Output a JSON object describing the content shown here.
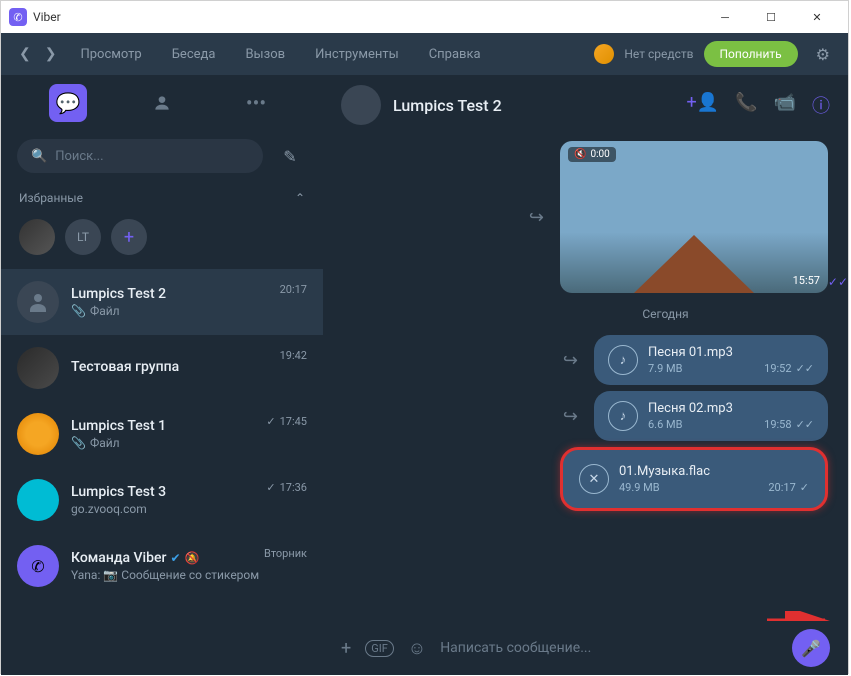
{
  "app": {
    "title": "Viber"
  },
  "menubar": {
    "items": [
      "Просмотр",
      "Беседа",
      "Вызов",
      "Инструменты",
      "Справка"
    ],
    "balance": "Нет средств",
    "topup": "Пополнить"
  },
  "sidebar": {
    "search_placeholder": "Поиск...",
    "favorites_label": "Избранные",
    "fav_lt": "LT",
    "chats": [
      {
        "name": "Lumpics Test 2",
        "preview": "Файл",
        "time": "20:17",
        "pin": true,
        "selected": true
      },
      {
        "name": "Тестовая группа",
        "preview": "",
        "time": "19:42"
      },
      {
        "name": "Lumpics Test 1",
        "preview": "Файл",
        "time": "17:45",
        "pin": true,
        "delivered": true
      },
      {
        "name": "Lumpics Test 3",
        "preview": "go.zvooq.com",
        "time": "17:36",
        "delivered": true
      },
      {
        "name": "Команда Viber",
        "preview": "Yana: 📷 Сообщение со стикером",
        "time": "Вторник",
        "verified": true,
        "muted": true
      }
    ]
  },
  "header": {
    "name": "Lumpics Test 2"
  },
  "messages": {
    "video": {
      "mute_time": "0:00",
      "duration": "15:57"
    },
    "date_separator": "Сегодня",
    "files": [
      {
        "name": "Песня 01.mp3",
        "size": "7.9 MB",
        "time": "19:52"
      },
      {
        "name": "Песня 02.mp3",
        "size": "6.6 MB",
        "time": "19:58"
      },
      {
        "name": "01.Музыка.flac",
        "size": "49.9 MB",
        "time": "20:17",
        "uploading": true
      }
    ]
  },
  "input": {
    "placeholder": "Написать сообщение...",
    "gif": "GIF"
  }
}
